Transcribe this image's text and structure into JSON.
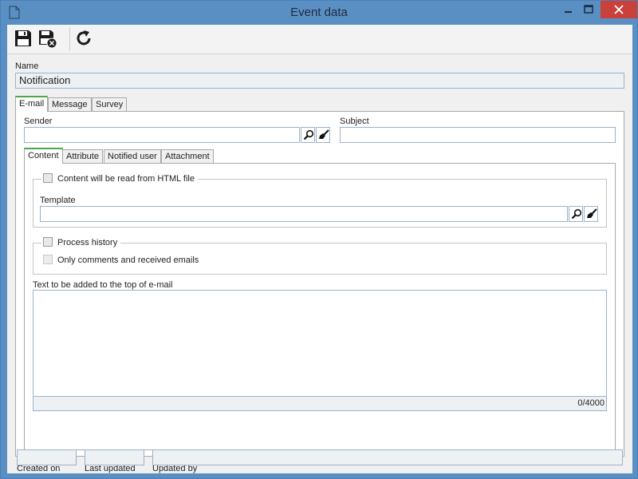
{
  "window": {
    "title": "Event data"
  },
  "toolbar": {
    "save": "save-icon",
    "save_exit": "save-and-exit-icon",
    "refresh": "refresh-icon"
  },
  "name": {
    "label": "Name",
    "value": "Notification"
  },
  "main_tabs": [
    {
      "label": "E-mail",
      "active": true
    },
    {
      "label": "Message",
      "active": false
    },
    {
      "label": "Survey",
      "active": false
    }
  ],
  "email": {
    "sender_label": "Sender",
    "sender_value": "",
    "subject_label": "Subject",
    "subject_value": "",
    "sub_tabs": [
      {
        "label": "Content",
        "active": true
      },
      {
        "label": "Attribute",
        "active": false
      },
      {
        "label": "Notified user",
        "active": false
      },
      {
        "label": "Attachment",
        "active": false
      }
    ],
    "html_group_label": "Content will be read from HTML file",
    "template_label": "Template",
    "template_value": "",
    "history_group_label": "Process history",
    "only_comments_label": "Only comments and received emails",
    "text_top_label": "Text to be added to the top of e-mail",
    "text_top_value": "",
    "counter": "0/4000"
  },
  "footer": {
    "created_on_label": "Created on",
    "last_updated_label": "Last updated",
    "updated_by_label": "Updated by",
    "created_on": "",
    "last_updated": "",
    "updated_by": ""
  }
}
